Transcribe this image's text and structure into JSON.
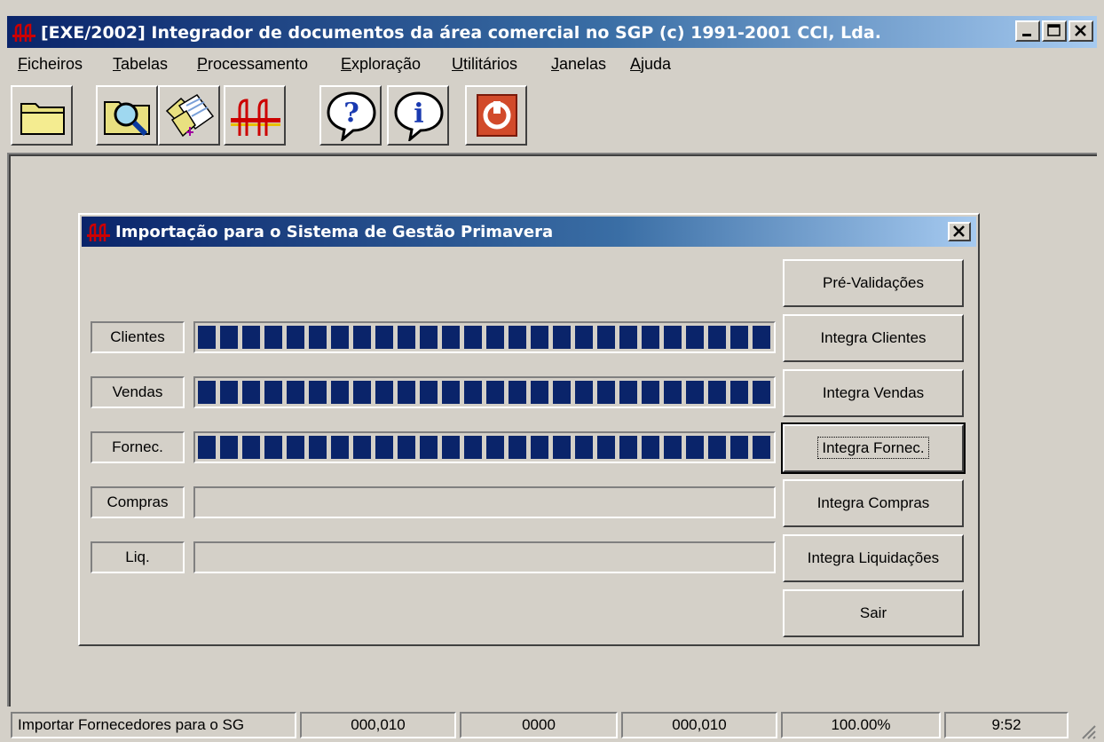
{
  "window": {
    "title": "[EXE/2002] Integrador de documentos da área comercial no SGP  (c) 1991-2001 CCI, Lda.",
    "minimize_icon": "minimize-icon",
    "maximize_icon": "maximize-icon",
    "close_icon": "close-icon"
  },
  "menu": {
    "items": [
      "Ficheiros",
      "Tabelas",
      "Processamento",
      "Exploração",
      "Utilitários",
      "Janelas",
      "Ajuda"
    ]
  },
  "toolbar": {
    "buttons": [
      "folder-icon",
      "search-icon",
      "documents-icon",
      "bridge-icon",
      "help-icon",
      "info-icon",
      "power-icon"
    ]
  },
  "dialog": {
    "title": "Importação para o Sistema de Gestão Primavera",
    "rows": [
      {
        "label": "Clientes",
        "progress": 1.0
      },
      {
        "label": "Vendas",
        "progress": 1.0
      },
      {
        "label": "Fornec.",
        "progress": 1.0
      },
      {
        "label": "Compras",
        "progress": 0.0
      },
      {
        "label": "Liq.",
        "progress": 0.0
      }
    ],
    "buttons": {
      "pre_validacoes": "Pré-Validações",
      "integra_clientes": "Integra Clientes",
      "integra_vendas": "Integra Vendas",
      "integra_fornec": "Integra Fornec.",
      "integra_compras": "Integra Compras",
      "integra_liquidacoes": "Integra Liquidações",
      "sair": "Sair"
    }
  },
  "statusbar": {
    "message": "Importar Fornecedores para o SG",
    "field1": "000,010",
    "field2": "0000",
    "field3": "000,010",
    "field4": "100.00%",
    "time": "9:52"
  },
  "colors": {
    "titlebar_start": "#0a246a",
    "titlebar_end": "#a6caf0",
    "face": "#d4d0c8",
    "progress": "#0a246a",
    "logo": "#cc0000"
  }
}
